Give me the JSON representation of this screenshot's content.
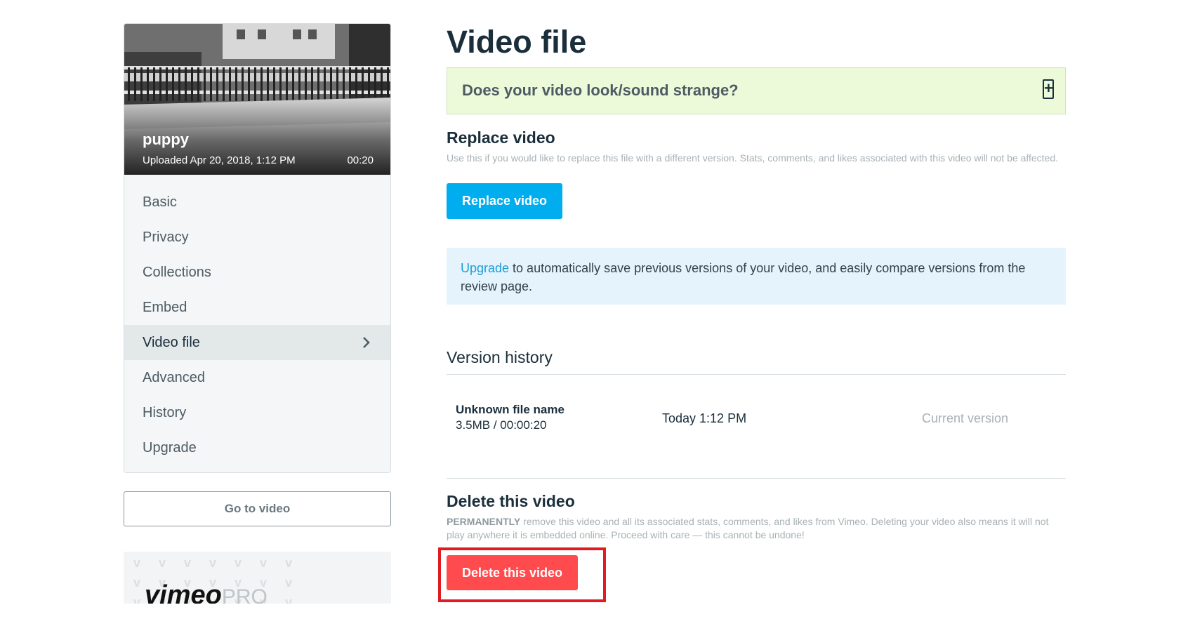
{
  "video": {
    "title": "puppy",
    "uploaded": "Uploaded Apr 20, 2018, 1:12 PM",
    "duration": "00:20"
  },
  "sidebar": {
    "items": [
      {
        "label": "Basic"
      },
      {
        "label": "Privacy"
      },
      {
        "label": "Collections"
      },
      {
        "label": "Embed"
      },
      {
        "label": "Video file",
        "active": true
      },
      {
        "label": "Advanced"
      },
      {
        "label": "History"
      },
      {
        "label": "Upgrade"
      }
    ],
    "go_to_video": "Go to video",
    "promo_logo": "vimeo",
    "promo_logo_suffix": "PRO"
  },
  "main": {
    "title": "Video file",
    "help_question": "Does your video look/sound strange?",
    "help_toggle": "+",
    "replace": {
      "title": "Replace video",
      "description": "Use this if you would like to replace this file with a different version. Stats, comments, and likes associated with this video will not be affected.",
      "button": "Replace video"
    },
    "upgrade_info": {
      "link": "Upgrade",
      "text": " to automatically save previous versions of your video, and easily compare versions from the review page."
    },
    "version_history": {
      "title": "Version history",
      "rows": [
        {
          "name": "Unknown file name",
          "size": "3.5MB / 00:00:20",
          "time": "Today 1:12 PM",
          "status": "Current version"
        }
      ]
    },
    "delete": {
      "title": "Delete this video",
      "desc_emphasis": "PERMANENTLY",
      "desc_rest": " remove this video and all its associated stats, comments, and likes from Vimeo. Deleting your video also means it will not play anywhere it is embedded online. Proceed with care — this cannot be undone!",
      "button": "Delete this video"
    }
  },
  "colors": {
    "accent_blue": "#00adef",
    "danger_red": "#ff4b4e",
    "highlight_red": "#e11b22",
    "help_bg": "#ecfad9",
    "info_bg": "#e4f3fc"
  }
}
